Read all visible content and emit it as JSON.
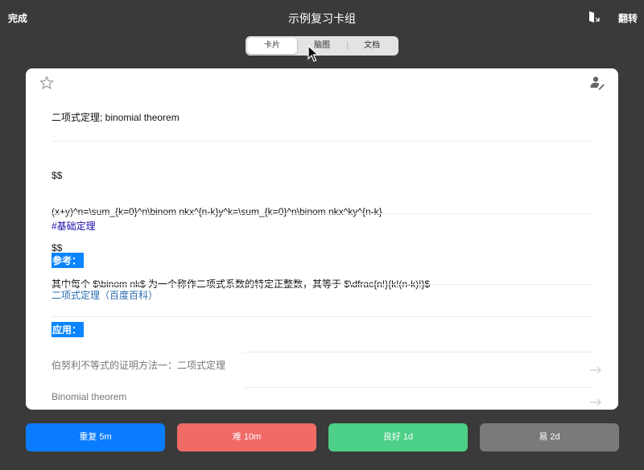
{
  "topbar": {
    "done_label": "完成",
    "title": "示例复习卡组",
    "flip_label": "翻转"
  },
  "view_tabs": [
    {
      "label": "卡片",
      "active": true
    },
    {
      "label": "脑图",
      "active": false
    },
    {
      "label": "文档",
      "active": false
    }
  ],
  "card": {
    "front": "二项式定理; binomial theorem",
    "formula_lines": [
      "$$",
      "(x+y)^n=\\sum_{k=0}^n\\binom nkx^{n-k}y^k=\\sum_{k=0}^n\\binom nkx^ky^{n-k}",
      "$$",
      "其中每个 $\\binom nk$ 为一个称作二项式系数的特定正整数，其等于 $\\dfrac{n!}{k!(n-k)!}$"
    ],
    "tag": "#基础定理",
    "reference_heading": "参考：",
    "reference_link": "二项式定理（百度百科）",
    "application_heading": "应用：",
    "related_items": [
      "伯努利不等式的证明方法一：二项式定理",
      "Binomial theorem"
    ]
  },
  "answer_buttons": [
    {
      "label": "重复 5m",
      "color": "#0a7cff"
    },
    {
      "label": "难 10m",
      "color": "#f06a66"
    },
    {
      "label": "良好 1d",
      "color": "#4ccf86"
    },
    {
      "label": "易 2d",
      "color": "#7a7a7a"
    }
  ],
  "icons": {
    "star": "star-icon",
    "editor": "user-edit-icon",
    "exit": "exit-door-icon",
    "arrow": "arrow-right-icon"
  }
}
